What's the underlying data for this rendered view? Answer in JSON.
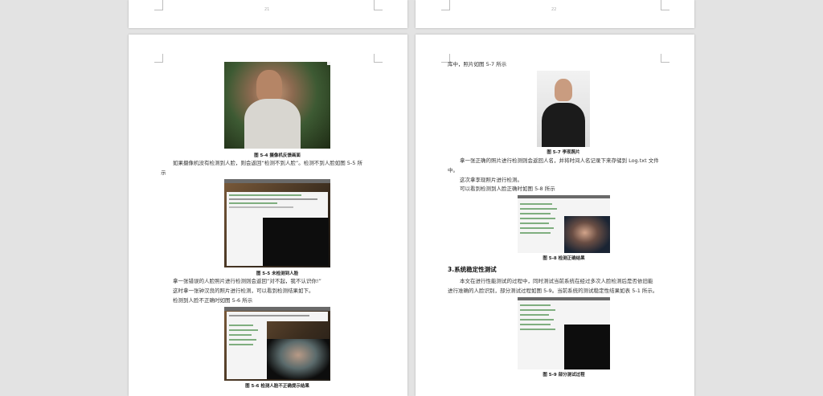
{
  "pages": {
    "top_left_number": "21",
    "top_right_number": "22"
  },
  "left": {
    "fig54_caption": "图 5-4 摄像机反馈画面",
    "para1_line1": "如果摄像机没有检测到人脸，则会返回“检测不到人脸”。检测不到人脸如图 5-5 所",
    "para1_line2": "示",
    "fig55_caption": "图 5-5 未检测到人脸",
    "terminal_cmd1": "$ sudo python facRate.py test_img.py",
    "para2_line1": "拿一张错误的人脸照片进行检测则会返回“对不起，我不认识你!”",
    "para2_line2": "这时拿一张钟汉良的照片进行检测，可以看到检测结果如下。",
    "para2_line3": "检测到人脸不正确时如图 5-6 所示",
    "fig56_caption": "图 5-6 检测人脸不正确提示结果"
  },
  "right": {
    "intro_line": "库中，照片如图 5-7 所示",
    "fig57_caption": "图 5-7 李现照片",
    "para1_line1": "拿一张正确的照片进行检测则会返回人名，并将时间人名记录下来存储到 Log.txt 文件",
    "para1_line2": "中。",
    "para2_line1": "这次拿李现照片进行检测。",
    "para2_line2": "可以看到检测到人脸正确时如图 5-8 所示",
    "fig58_caption": "图 5-8 检测正确结果",
    "section_heading": "3.系统稳定性测试",
    "para3_line1": "本文在进行性能测试的过程中，同时测试当前系统在经过多次人脸检测后是否依旧能",
    "para3_line2": "进行准确的人脸识别，部分测试过程如图 5-9。当前系统的测试稳定性结果如表 5-1 所示。",
    "fig59_caption": "图 5-9 部分测试过程"
  },
  "colors": {
    "background": "#e3e3e3",
    "page": "#ffffff",
    "terminal_dark": "#0d0d0d"
  }
}
